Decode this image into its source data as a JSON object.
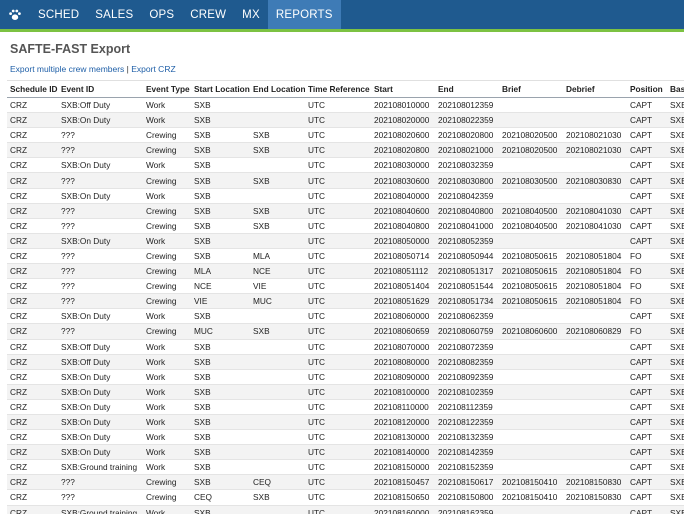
{
  "nav": {
    "items": [
      "SCHED",
      "SALES",
      "OPS",
      "CREW",
      "MX",
      "REPORTS"
    ],
    "active": "REPORTS"
  },
  "page": {
    "title": "SAFTE-FAST Export",
    "link_multi": "Export multiple crew members",
    "separator": " | ",
    "link_crz": "Export CRZ"
  },
  "table": {
    "columns": [
      "Schedule ID",
      "Event ID",
      "Event Type",
      "Start Location",
      "End Location",
      "Time Reference",
      "Start",
      "End",
      "Brief",
      "Debrief",
      "Position",
      "Base"
    ],
    "rows": [
      [
        "CRZ",
        "SXB:Off Duty",
        "Work",
        "SXB",
        "",
        "UTC",
        "202108010000",
        "202108012359",
        "",
        "",
        "CAPT",
        "SXB"
      ],
      [
        "CRZ",
        "SXB:On Duty",
        "Work",
        "SXB",
        "",
        "UTC",
        "202108020000",
        "202108022359",
        "",
        "",
        "CAPT",
        "SXB"
      ],
      [
        "CRZ",
        "???",
        "Crewing",
        "SXB",
        "SXB",
        "UTC",
        "202108020600",
        "202108020800",
        "202108020500",
        "202108021030",
        "CAPT",
        "SXB"
      ],
      [
        "CRZ",
        "???",
        "Crewing",
        "SXB",
        "SXB",
        "UTC",
        "202108020800",
        "202108021000",
        "202108020500",
        "202108021030",
        "CAPT",
        "SXB"
      ],
      [
        "CRZ",
        "SXB:On Duty",
        "Work",
        "SXB",
        "",
        "UTC",
        "202108030000",
        "202108032359",
        "",
        "",
        "CAPT",
        "SXB"
      ],
      [
        "CRZ",
        "???",
        "Crewing",
        "SXB",
        "SXB",
        "UTC",
        "202108030600",
        "202108030800",
        "202108030500",
        "202108030830",
        "CAPT",
        "SXB"
      ],
      [
        "CRZ",
        "SXB:On Duty",
        "Work",
        "SXB",
        "",
        "UTC",
        "202108040000",
        "202108042359",
        "",
        "",
        "CAPT",
        "SXB"
      ],
      [
        "CRZ",
        "???",
        "Crewing",
        "SXB",
        "SXB",
        "UTC",
        "202108040600",
        "202108040800",
        "202108040500",
        "202108041030",
        "CAPT",
        "SXB"
      ],
      [
        "CRZ",
        "???",
        "Crewing",
        "SXB",
        "SXB",
        "UTC",
        "202108040800",
        "202108041000",
        "202108040500",
        "202108041030",
        "CAPT",
        "SXB"
      ],
      [
        "CRZ",
        "SXB:On Duty",
        "Work",
        "SXB",
        "",
        "UTC",
        "202108050000",
        "202108052359",
        "",
        "",
        "CAPT",
        "SXB"
      ],
      [
        "CRZ",
        "???",
        "Crewing",
        "SXB",
        "MLA",
        "UTC",
        "202108050714",
        "202108050944",
        "202108050615",
        "202108051804",
        "FO",
        "SXB"
      ],
      [
        "CRZ",
        "???",
        "Crewing",
        "MLA",
        "NCE",
        "UTC",
        "202108051112",
        "202108051317",
        "202108050615",
        "202108051804",
        "FO",
        "SXB"
      ],
      [
        "CRZ",
        "???",
        "Crewing",
        "NCE",
        "VIE",
        "UTC",
        "202108051404",
        "202108051544",
        "202108050615",
        "202108051804",
        "FO",
        "SXB"
      ],
      [
        "CRZ",
        "???",
        "Crewing",
        "VIE",
        "MUC",
        "UTC",
        "202108051629",
        "202108051734",
        "202108050615",
        "202108051804",
        "FO",
        "SXB"
      ],
      [
        "CRZ",
        "SXB:On Duty",
        "Work",
        "SXB",
        "",
        "UTC",
        "202108060000",
        "202108062359",
        "",
        "",
        "CAPT",
        "SXB"
      ],
      [
        "CRZ",
        "???",
        "Crewing",
        "MUC",
        "SXB",
        "UTC",
        "202108060659",
        "202108060759",
        "202108060600",
        "202108060829",
        "FO",
        "SXB"
      ],
      [
        "CRZ",
        "SXB:Off Duty",
        "Work",
        "SXB",
        "",
        "UTC",
        "202108070000",
        "202108072359",
        "",
        "",
        "CAPT",
        "SXB"
      ],
      [
        "CRZ",
        "SXB:Off Duty",
        "Work",
        "SXB",
        "",
        "UTC",
        "202108080000",
        "202108082359",
        "",
        "",
        "CAPT",
        "SXB"
      ],
      [
        "CRZ",
        "SXB:On Duty",
        "Work",
        "SXB",
        "",
        "UTC",
        "202108090000",
        "202108092359",
        "",
        "",
        "CAPT",
        "SXB"
      ],
      [
        "CRZ",
        "SXB:On Duty",
        "Work",
        "SXB",
        "",
        "UTC",
        "202108100000",
        "202108102359",
        "",
        "",
        "CAPT",
        "SXB"
      ],
      [
        "CRZ",
        "SXB:On Duty",
        "Work",
        "SXB",
        "",
        "UTC",
        "202108110000",
        "202108112359",
        "",
        "",
        "CAPT",
        "SXB"
      ],
      [
        "CRZ",
        "SXB:On Duty",
        "Work",
        "SXB",
        "",
        "UTC",
        "202108120000",
        "202108122359",
        "",
        "",
        "CAPT",
        "SXB"
      ],
      [
        "CRZ",
        "SXB:On Duty",
        "Work",
        "SXB",
        "",
        "UTC",
        "202108130000",
        "202108132359",
        "",
        "",
        "CAPT",
        "SXB"
      ],
      [
        "CRZ",
        "SXB:On Duty",
        "Work",
        "SXB",
        "",
        "UTC",
        "202108140000",
        "202108142359",
        "",
        "",
        "CAPT",
        "SXB"
      ],
      [
        "CRZ",
        "SXB:Ground training",
        "Work",
        "SXB",
        "",
        "UTC",
        "202108150000",
        "202108152359",
        "",
        "",
        "CAPT",
        "SXB"
      ],
      [
        "CRZ",
        "???",
        "Crewing",
        "SXB",
        "CEQ",
        "UTC",
        "202108150457",
        "202108150617",
        "202108150410",
        "202108150830",
        "CAPT",
        "SXB"
      ],
      [
        "CRZ",
        "???",
        "Crewing",
        "CEQ",
        "SXB",
        "UTC",
        "202108150650",
        "202108150800",
        "202108150410",
        "202108150830",
        "CAPT",
        "SXB"
      ],
      [
        "CRZ",
        "SXB:Ground training",
        "Work",
        "SXB",
        "",
        "UTC",
        "202108160000",
        "202108162359",
        "",
        "",
        "CAPT",
        "SXB"
      ]
    ]
  },
  "colors": {
    "navbar": "#1f5a8f",
    "navbar_active": "#3e7bb6",
    "accent_line": "#7cc242",
    "link": "#2060a8"
  },
  "icons": {
    "logo": "paw-icon"
  }
}
